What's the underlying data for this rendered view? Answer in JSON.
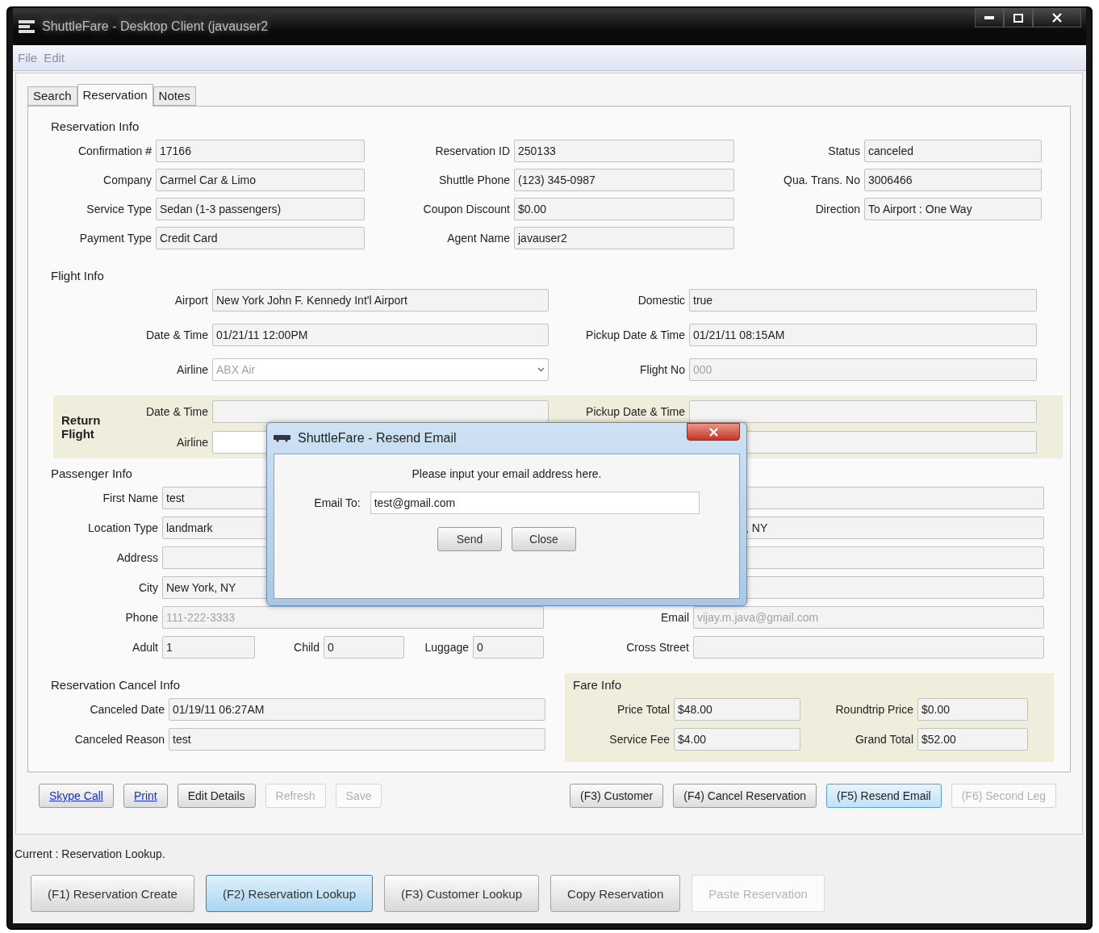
{
  "window": {
    "title": "ShuttleFare - Desktop Client (javauser2"
  },
  "menu": [
    "File",
    "Edit"
  ],
  "tabs": [
    {
      "label": "Search",
      "selected": false
    },
    {
      "label": "Reservation",
      "selected": true
    },
    {
      "label": "Notes",
      "selected": false
    }
  ],
  "reservation_info": {
    "title": "Reservation Info",
    "fields": [
      {
        "label": "Confirmation #",
        "value": "17166",
        "kind": "readonly",
        "disabled": false
      },
      {
        "label": "Reservation ID",
        "value": "250133",
        "kind": "readonly",
        "disabled": false
      },
      {
        "label": "Status",
        "value": "canceled",
        "kind": "readonly",
        "disabled": false
      },
      {
        "label": "Company",
        "value": "Carmel Car & Limo",
        "kind": "readonly",
        "disabled": false
      },
      {
        "label": "Shuttle Phone",
        "value": "(123) 345-0987",
        "kind": "readonly",
        "disabled": false
      },
      {
        "label": "Qua. Trans. No",
        "value": "3006466",
        "kind": "readonly",
        "disabled": false
      },
      {
        "label": "Service Type",
        "value": "Sedan (1-3 passengers)",
        "kind": "readonly",
        "disabled": false
      },
      {
        "label": "Coupon Discount",
        "value": "$0.00",
        "kind": "readonly",
        "disabled": false
      },
      {
        "label": "Direction",
        "value": "To Airport : One Way",
        "kind": "readonly",
        "disabled": false
      },
      {
        "label": "Payment Type",
        "value": "Credit Card",
        "kind": "readonly",
        "disabled": false
      },
      {
        "label": "Agent Name",
        "value": "javauser2",
        "kind": "readonly",
        "disabled": false
      }
    ]
  },
  "flight_info": {
    "title": "Flight Info",
    "fields": [
      {
        "label": "Airport",
        "value": "New York John F. Kennedy Int'l Airport",
        "kind": "readonly",
        "disabled": false
      },
      {
        "label": "Domestic",
        "value": "true",
        "kind": "readonly",
        "disabled": false
      },
      {
        "label": "Date & Time",
        "value": "01/21/11 12:00PM",
        "kind": "readonly",
        "disabled": false
      },
      {
        "label": "Pickup Date & Time",
        "value": "01/21/11 08:15AM",
        "kind": "readonly",
        "disabled": false
      },
      {
        "label": "Airline",
        "value": "ABX Air",
        "kind": "combo",
        "disabled": true
      },
      {
        "label": "Flight No",
        "value": "000",
        "kind": "readonly",
        "disabled": true
      }
    ]
  },
  "return_flight": {
    "title": "Return Flight",
    "fields": [
      {
        "label": "Date & Time",
        "kind": "readonly"
      },
      {
        "label": "Pickup Date & Time",
        "kind": "readonly"
      },
      {
        "label": "Airline",
        "kind": "input"
      },
      {
        "kind": "readonly"
      }
    ]
  },
  "passenger_info": {
    "title": "Passenger Info",
    "fields": [
      {
        "label": "First Name",
        "value": "test",
        "kind": "readonly",
        "disabled": false
      },
      {
        "kind": "readonly"
      },
      {
        "label": "Location Type",
        "value": "landmark",
        "kind": "readonly",
        "disabled": false
      },
      {
        "value": ", NY",
        "kind": "covered",
        "disabled": false
      },
      {
        "label": "Address",
        "kind": "readonly"
      },
      {
        "kind": "readonly"
      },
      {
        "label": "City",
        "value": "New York, NY",
        "kind": "readonly",
        "disabled": false
      },
      {
        "kind": "readonly"
      },
      {
        "label": "Phone",
        "value": "111-222-3333",
        "kind": "readonly",
        "disabled": true
      },
      {
        "label": "Email",
        "value": "vijay.m.java@gmail.com",
        "kind": "readonly",
        "disabled": true
      },
      {
        "kind": "group",
        "fields": [
          {
            "label": "Adult",
            "value": "1",
            "kind": "readonly",
            "disabled": false
          },
          {
            "label": "Child",
            "value": "0",
            "kind": "readonly",
            "disabled": false
          },
          {
            "label": "Luggage",
            "value": "0",
            "kind": "readonly",
            "disabled": false
          }
        ]
      },
      {
        "label": "Cross Street",
        "kind": "readonly"
      }
    ]
  },
  "cancel_info": {
    "title": "Reservation Cancel Info",
    "fields": [
      {
        "label": "Canceled Date",
        "value": "01/19/11 06:27AM",
        "kind": "readonly",
        "disabled": false
      },
      {
        "label": "Canceled Reason",
        "value": "test",
        "kind": "readonly",
        "disabled": false
      }
    ]
  },
  "fare_info": {
    "title": "Fare Info",
    "fields": [
      {
        "label": "Price Total",
        "value": "$48.00",
        "kind": "readonly",
        "disabled": false
      },
      {
        "label": "Roundtrip Price",
        "value": "$0.00",
        "kind": "readonly",
        "disabled": false
      },
      {
        "label": "Service Fee",
        "value": "$4.00",
        "kind": "readonly",
        "disabled": false
      },
      {
        "label": "Grand Total",
        "value": "$52.00",
        "kind": "readonly",
        "disabled": false
      }
    ]
  },
  "action_buttons": {
    "left": [
      {
        "label": "Skype Call",
        "kind": "link",
        "disabled": false,
        "highlighted": false
      },
      {
        "label": "Print",
        "kind": "link",
        "disabled": false,
        "highlighted": false
      },
      {
        "label": "Edit Details",
        "kind": "button",
        "disabled": false,
        "highlighted": false
      },
      {
        "label": "Refresh",
        "kind": "button",
        "disabled": true,
        "highlighted": false
      },
      {
        "label": "Save",
        "kind": "button",
        "disabled": true,
        "highlighted": false
      }
    ],
    "right": [
      {
        "label": "(F3) Customer",
        "kind": "button",
        "disabled": false,
        "highlighted": false
      },
      {
        "label": "(F4) Cancel Reservation",
        "kind": "button",
        "disabled": false,
        "highlighted": false
      },
      {
        "label": "(F5) Resend Email",
        "kind": "button",
        "disabled": false,
        "highlighted": true
      },
      {
        "label": "(F6) Second Leg",
        "kind": "button",
        "disabled": true,
        "highlighted": false
      }
    ]
  },
  "status": "Current : Reservation Lookup.",
  "nav_buttons": [
    {
      "label": "(F1) Reservation Create",
      "disabled": false,
      "selected": false
    },
    {
      "label": "(F2) Reservation Lookup",
      "disabled": false,
      "selected": true
    },
    {
      "label": "(F3) Customer Lookup",
      "disabled": false,
      "selected": false
    },
    {
      "label": "Copy Reservation",
      "disabled": false,
      "selected": false
    },
    {
      "label": "Paste Reservation",
      "disabled": true,
      "selected": false
    }
  ],
  "dialog": {
    "title": "ShuttleFare - Resend Email",
    "message": "Please input your email address here.",
    "field": {
      "label": "Email To:",
      "value": "test@gmail.com"
    },
    "buttons": [
      "Send",
      "Close"
    ]
  }
}
